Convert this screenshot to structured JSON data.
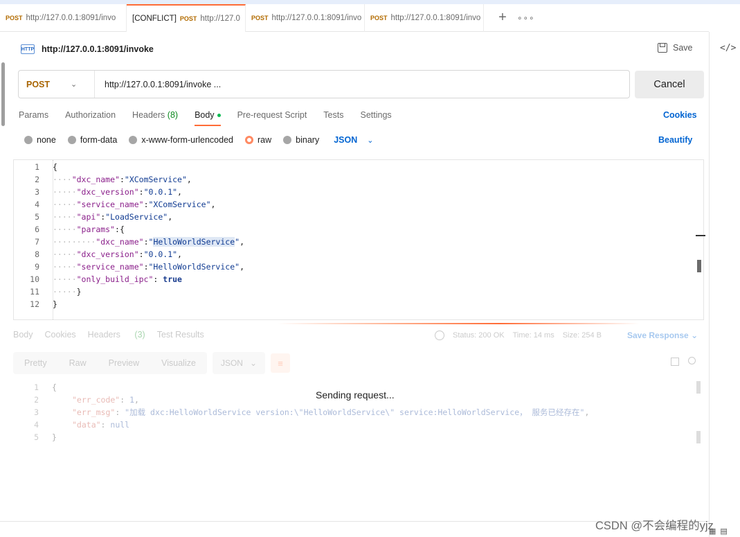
{
  "tabs": [
    {
      "prefix": "",
      "method": "POST",
      "url": "http://127.0.0.1:8091/invo"
    },
    {
      "prefix": "[CONFLICT]",
      "method": "POST",
      "url": "http://127.0"
    },
    {
      "prefix": "",
      "method": "POST",
      "url": "http://127.0.0.1:8091/invo"
    },
    {
      "prefix": "",
      "method": "POST",
      "url": "http://127.0.0.1:8091/invo"
    }
  ],
  "tab_actions": {
    "add": "+",
    "more": "∘∘∘"
  },
  "request": {
    "icon_label": "HTTP",
    "title": "http://127.0.0.1:8091/invoke",
    "save_label": "Save",
    "method": "POST",
    "url": "http://127.0.0.1:8091/invoke ...",
    "send_label": "Cancel"
  },
  "request_tabs": {
    "params": "Params",
    "authorization": "Authorization",
    "headers": "Headers",
    "headers_count": "(8)",
    "body": "Body",
    "prerequest": "Pre-request Script",
    "tests": "Tests",
    "settings": "Settings",
    "cookies": "Cookies"
  },
  "body_types": {
    "none": "none",
    "form_data": "form-data",
    "urlencoded": "x-www-form-urlencoded",
    "raw": "raw",
    "binary": "binary",
    "format": "JSON",
    "selected": "raw",
    "beautify": "Beautify"
  },
  "editor_lines": [
    {
      "n": "1",
      "indent": "",
      "tokens": [
        [
          "p",
          "{"
        ]
      ]
    },
    {
      "n": "2",
      "indent": "····",
      "tokens": [
        [
          "k",
          "\"dxc_name\""
        ],
        [
          "p",
          ":"
        ],
        [
          "s",
          "\"XComService\""
        ],
        [
          "p",
          ","
        ]
      ]
    },
    {
      "n": "3",
      "indent": "·····",
      "tokens": [
        [
          "k",
          "\"dxc_version\""
        ],
        [
          "p",
          ":"
        ],
        [
          "s",
          "\"0.0.1\""
        ],
        [
          "p",
          ","
        ]
      ]
    },
    {
      "n": "4",
      "indent": "·····",
      "tokens": [
        [
          "k",
          "\"service_name\""
        ],
        [
          "p",
          ":"
        ],
        [
          "s",
          "\"XComService\""
        ],
        [
          "p",
          ","
        ]
      ]
    },
    {
      "n": "5",
      "indent": "·····",
      "tokens": [
        [
          "k",
          "\"api\""
        ],
        [
          "p",
          ":"
        ],
        [
          "s",
          "\"LoadService\""
        ],
        [
          "p",
          ","
        ]
      ]
    },
    {
      "n": "6",
      "indent": "·····",
      "tokens": [
        [
          "k",
          "\"params\""
        ],
        [
          "p",
          ":{"
        ]
      ]
    },
    {
      "n": "7",
      "indent": "·········",
      "tokens": [
        [
          "k",
          "\"dxc_name\""
        ],
        [
          "p",
          ":"
        ],
        [
          "s",
          "\""
        ],
        [
          "sh",
          "HelloWorldService"
        ],
        [
          "s",
          "\""
        ],
        [
          "p",
          ","
        ]
      ]
    },
    {
      "n": "8",
      "indent": "·····",
      "tokens": [
        [
          "k",
          "\"dxc_version\""
        ],
        [
          "p",
          ":"
        ],
        [
          "s",
          "\"0.0.1\""
        ],
        [
          "p",
          ","
        ]
      ]
    },
    {
      "n": "9",
      "indent": "·····",
      "tokens": [
        [
          "k",
          "\"service_name\""
        ],
        [
          "p",
          ":"
        ],
        [
          "s",
          "\"HelloWorldService\""
        ],
        [
          "p",
          ","
        ]
      ]
    },
    {
      "n": "10",
      "indent": "·····",
      "tokens": [
        [
          "k",
          "\"only_build_ipc\""
        ],
        [
          "p",
          ": "
        ],
        [
          "b",
          "true"
        ]
      ]
    },
    {
      "n": "11",
      "indent": "·····",
      "tokens": [
        [
          "p",
          "}"
        ]
      ]
    },
    {
      "n": "12",
      "indent": "",
      "tokens": [
        [
          "p",
          "}"
        ]
      ]
    }
  ],
  "response": {
    "tabs": [
      "Body",
      "Cookies",
      "Headers",
      "Test Results"
    ],
    "headers_count": "(3)",
    "status": "Status: 200 OK",
    "time": "Time: 14 ms",
    "size": "Size: 254 B",
    "save_response": "Save Response",
    "views": [
      "Pretty",
      "Raw",
      "Preview",
      "Visualize"
    ],
    "format": "JSON",
    "sending": "Sending request...",
    "lines": [
      {
        "n": "1",
        "tokens": [
          [
            "p",
            "{"
          ]
        ]
      },
      {
        "n": "2",
        "tokens": [
          [
            "k",
            "\"err_code\""
          ],
          [
            "p",
            ": "
          ],
          [
            "b",
            "1"
          ],
          [
            "p",
            ","
          ]
        ]
      },
      {
        "n": "3",
        "tokens": [
          [
            "k",
            "\"err_msg\""
          ],
          [
            "p",
            ": "
          ],
          [
            "s",
            "\"加载 dxc:HelloWorldService version:\\\"HelloWorldService\\\" service:HelloWorldService， 服务已经存在\""
          ],
          [
            "p",
            ","
          ]
        ]
      },
      {
        "n": "4",
        "tokens": [
          [
            "k",
            "\"data\""
          ],
          [
            "p",
            ": "
          ],
          [
            "b",
            "null"
          ]
        ]
      },
      {
        "n": "5",
        "tokens": [
          [
            "p",
            "}"
          ]
        ]
      }
    ]
  },
  "watermark": "CSDN @不会编程的yjz",
  "colors": {
    "accent": "#ff6c37",
    "link": "#0265d2",
    "method": "#a86400"
  }
}
